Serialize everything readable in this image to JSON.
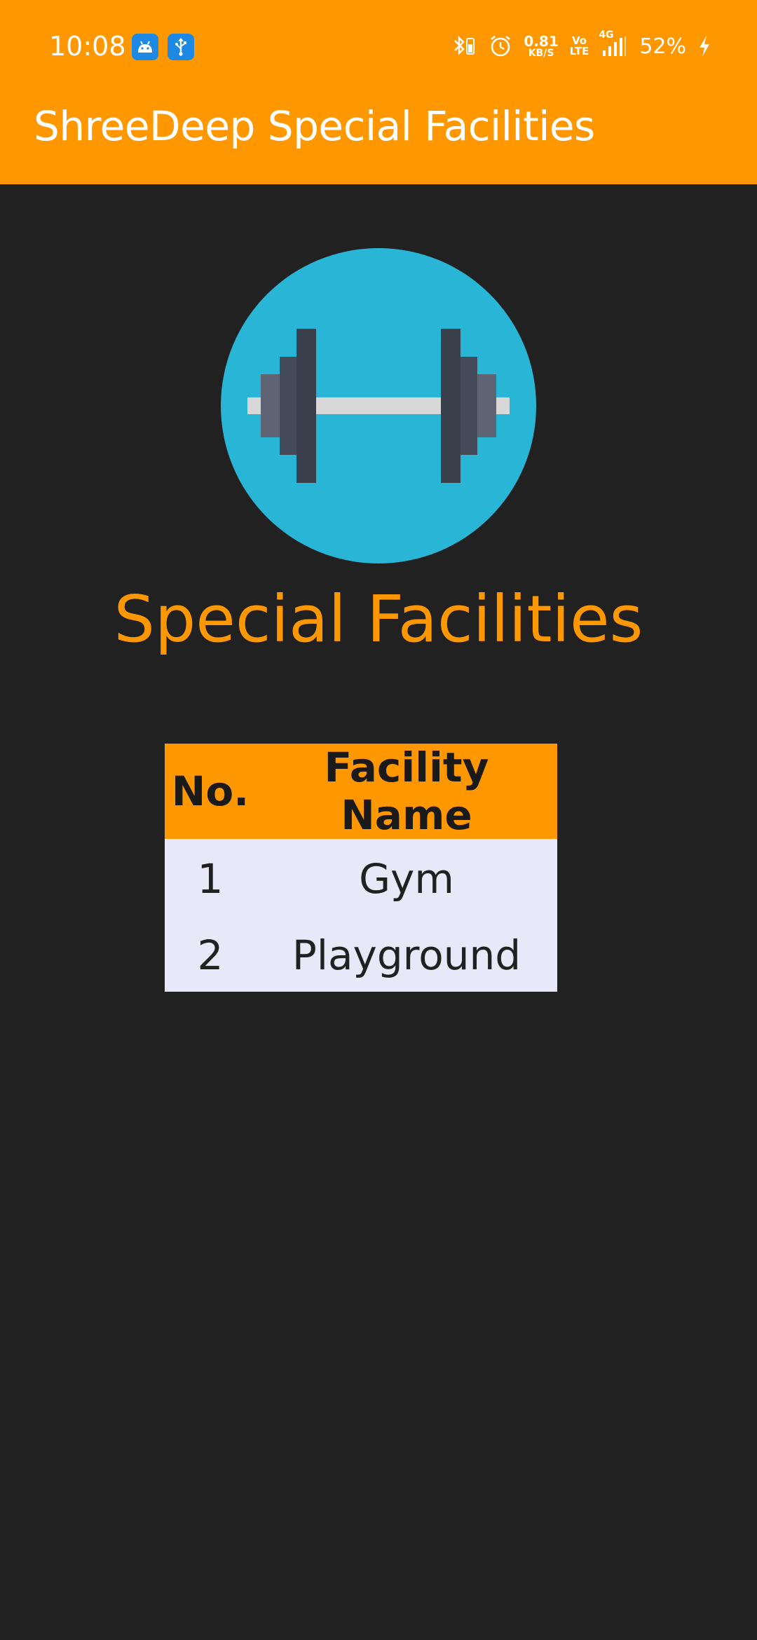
{
  "status_bar": {
    "time": "10:08",
    "net_speed_value": "0.81",
    "net_speed_unit": "KB/S",
    "volte_top": "Vo",
    "volte_bottom": "LTE",
    "network_type": "4G",
    "battery": "52%",
    "icons": [
      "android-notification-icon",
      "usb-notification-icon",
      "bluetooth-icon",
      "alarm-icon",
      "signal-icon",
      "charging-icon"
    ]
  },
  "app_bar": {
    "title": "ShreeDeep Special Facilities"
  },
  "main": {
    "hero_icon": "dumbbell-icon",
    "section_title": "Special Facilities",
    "table": {
      "headers": [
        "No.",
        "Facility Name"
      ],
      "rows": [
        [
          "1",
          "Gym"
        ],
        [
          "2",
          "Playground"
        ]
      ]
    }
  },
  "colors": {
    "accent": "#FF9800",
    "background": "#212121",
    "table_row_bg": "#E8E8F8",
    "icon_circle": "#29B6D6"
  }
}
